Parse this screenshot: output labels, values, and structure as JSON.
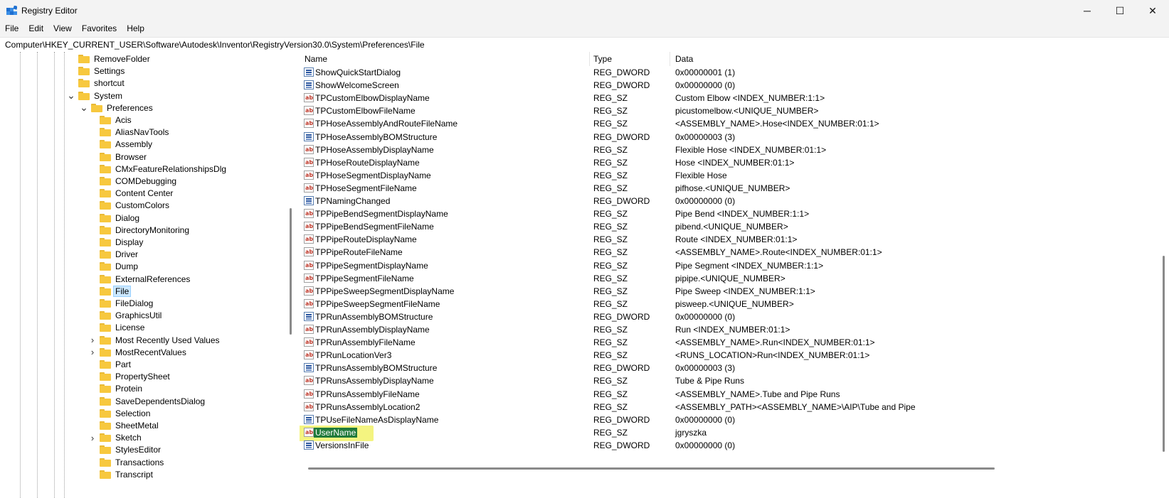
{
  "window": {
    "title": "Registry Editor",
    "minimize_glyph": "─",
    "maximize_glyph": "☐",
    "close_glyph": "✕"
  },
  "menu": [
    "File",
    "Edit",
    "View",
    "Favorites",
    "Help"
  ],
  "address": "Computer\\HKEY_CURRENT_USER\\Software\\Autodesk\\Inventor\\RegistryVersion30.0\\System\\Preferences\\File",
  "tree": {
    "items": [
      {
        "label": "RemoveFolder",
        "level": 1,
        "chevron": ""
      },
      {
        "label": "Settings",
        "level": 1,
        "chevron": ""
      },
      {
        "label": "shortcut",
        "level": 1,
        "chevron": ""
      },
      {
        "label": "System",
        "level": 1,
        "chevron": "expanded"
      },
      {
        "label": "Preferences",
        "level": 2,
        "chevron": "expanded"
      },
      {
        "label": "Acis",
        "level": 3,
        "chevron": ""
      },
      {
        "label": "AliasNavTools",
        "level": 3,
        "chevron": ""
      },
      {
        "label": "Assembly",
        "level": 3,
        "chevron": ""
      },
      {
        "label": "Browser",
        "level": 3,
        "chevron": ""
      },
      {
        "label": "CMxFeatureRelationshipsDlg",
        "level": 3,
        "chevron": ""
      },
      {
        "label": "COMDebugging",
        "level": 3,
        "chevron": ""
      },
      {
        "label": "Content Center",
        "level": 3,
        "chevron": ""
      },
      {
        "label": "CustomColors",
        "level": 3,
        "chevron": ""
      },
      {
        "label": "Dialog",
        "level": 3,
        "chevron": ""
      },
      {
        "label": "DirectoryMonitoring",
        "level": 3,
        "chevron": ""
      },
      {
        "label": "Display",
        "level": 3,
        "chevron": ""
      },
      {
        "label": "Driver",
        "level": 3,
        "chevron": ""
      },
      {
        "label": "Dump",
        "level": 3,
        "chevron": ""
      },
      {
        "label": "ExternalReferences",
        "level": 3,
        "chevron": ""
      },
      {
        "label": "File",
        "level": 3,
        "chevron": "",
        "selected": true
      },
      {
        "label": "FileDialog",
        "level": 3,
        "chevron": ""
      },
      {
        "label": "GraphicsUtil",
        "level": 3,
        "chevron": ""
      },
      {
        "label": "License",
        "level": 3,
        "chevron": ""
      },
      {
        "label": "Most Recently Used Values",
        "level": 3,
        "chevron": "collapsed"
      },
      {
        "label": "MostRecentValues",
        "level": 3,
        "chevron": "collapsed"
      },
      {
        "label": "Part",
        "level": 3,
        "chevron": ""
      },
      {
        "label": "PropertySheet",
        "level": 3,
        "chevron": ""
      },
      {
        "label": "Protein",
        "level": 3,
        "chevron": ""
      },
      {
        "label": "SaveDependentsDialog",
        "level": 3,
        "chevron": ""
      },
      {
        "label": "Selection",
        "level": 3,
        "chevron": ""
      },
      {
        "label": "SheetMetal",
        "level": 3,
        "chevron": ""
      },
      {
        "label": "Sketch",
        "level": 3,
        "chevron": "collapsed"
      },
      {
        "label": "StylesEditor",
        "level": 3,
        "chevron": ""
      },
      {
        "label": "Transactions",
        "level": 3,
        "chevron": ""
      },
      {
        "label": "Transcript",
        "level": 3,
        "chevron": ""
      }
    ]
  },
  "list": {
    "columns": [
      "Name",
      "Type",
      "Data"
    ],
    "rows": [
      {
        "icon": "dword-icon",
        "name": "ShowQuickStartDialog",
        "type": "REG_DWORD",
        "data": "0x00000001 (1)"
      },
      {
        "icon": "dword-icon",
        "name": "ShowWelcomeScreen",
        "type": "REG_DWORD",
        "data": "0x00000000 (0)"
      },
      {
        "icon": "string-icon",
        "name": "TPCustomElbowDisplayName",
        "type": "REG_SZ",
        "data": "Custom Elbow <INDEX_NUMBER:1:1>"
      },
      {
        "icon": "string-icon",
        "name": "TPCustomElbowFileName",
        "type": "REG_SZ",
        "data": "picustomelbow.<UNIQUE_NUMBER>"
      },
      {
        "icon": "string-icon",
        "name": "TPHoseAssemblyAndRouteFileName",
        "type": "REG_SZ",
        "data": "<ASSEMBLY_NAME>.Hose<INDEX_NUMBER:01:1>"
      },
      {
        "icon": "dword-icon",
        "name": "TPHoseAssemblyBOMStructure",
        "type": "REG_DWORD",
        "data": "0x00000003 (3)"
      },
      {
        "icon": "string-icon",
        "name": "TPHoseAssemblyDisplayName",
        "type": "REG_SZ",
        "data": "Flexible Hose <INDEX_NUMBER:01:1>"
      },
      {
        "icon": "string-icon",
        "name": "TPHoseRouteDisplayName",
        "type": "REG_SZ",
        "data": "Hose <INDEX_NUMBER:01:1>"
      },
      {
        "icon": "string-icon",
        "name": "TPHoseSegmentDisplayName",
        "type": "REG_SZ",
        "data": "Flexible Hose"
      },
      {
        "icon": "string-icon",
        "name": "TPHoseSegmentFileName",
        "type": "REG_SZ",
        "data": "pifhose.<UNIQUE_NUMBER>"
      },
      {
        "icon": "dword-icon",
        "name": "TPNamingChanged",
        "type": "REG_DWORD",
        "data": "0x00000000 (0)"
      },
      {
        "icon": "string-icon",
        "name": "TPPipeBendSegmentDisplayName",
        "type": "REG_SZ",
        "data": "Pipe Bend <INDEX_NUMBER:1:1>"
      },
      {
        "icon": "string-icon",
        "name": "TPPipeBendSegmentFileName",
        "type": "REG_SZ",
        "data": "pibend.<UNIQUE_NUMBER>"
      },
      {
        "icon": "string-icon",
        "name": "TPPipeRouteDisplayName",
        "type": "REG_SZ",
        "data": "Route <INDEX_NUMBER:01:1>"
      },
      {
        "icon": "string-icon",
        "name": "TPPipeRouteFileName",
        "type": "REG_SZ",
        "data": "<ASSEMBLY_NAME>.Route<INDEX_NUMBER:01:1>"
      },
      {
        "icon": "string-icon",
        "name": "TPPipeSegmentDisplayName",
        "type": "REG_SZ",
        "data": "Pipe Segment <INDEX_NUMBER:1:1>"
      },
      {
        "icon": "string-icon",
        "name": "TPPipeSegmentFileName",
        "type": "REG_SZ",
        "data": "pipipe.<UNIQUE_NUMBER>"
      },
      {
        "icon": "string-icon",
        "name": "TPPipeSweepSegmentDisplayName",
        "type": "REG_SZ",
        "data": "Pipe Sweep <INDEX_NUMBER:1:1>"
      },
      {
        "icon": "string-icon",
        "name": "TPPipeSweepSegmentFileName",
        "type": "REG_SZ",
        "data": "pisweep.<UNIQUE_NUMBER>"
      },
      {
        "icon": "dword-icon",
        "name": "TPRunAssemblyBOMStructure",
        "type": "REG_DWORD",
        "data": "0x00000000 (0)"
      },
      {
        "icon": "string-icon",
        "name": "TPRunAssemblyDisplayName",
        "type": "REG_SZ",
        "data": "Run <INDEX_NUMBER:01:1>"
      },
      {
        "icon": "string-icon",
        "name": "TPRunAssemblyFileName",
        "type": "REG_SZ",
        "data": "<ASSEMBLY_NAME>.Run<INDEX_NUMBER:01:1>"
      },
      {
        "icon": "string-icon",
        "name": "TPRunLocationVer3",
        "type": "REG_SZ",
        "data": "<RUNS_LOCATION>Run<INDEX_NUMBER:01:1>"
      },
      {
        "icon": "dword-icon",
        "name": "TPRunsAssemblyBOMStructure",
        "type": "REG_DWORD",
        "data": "0x00000003 (3)"
      },
      {
        "icon": "string-icon",
        "name": "TPRunsAssemblyDisplayName",
        "type": "REG_SZ",
        "data": "Tube & Pipe Runs"
      },
      {
        "icon": "string-icon",
        "name": "TPRunsAssemblyFileName",
        "type": "REG_SZ",
        "data": "<ASSEMBLY_NAME>.Tube and Pipe Runs"
      },
      {
        "icon": "string-icon",
        "name": "TPRunsAssemblyLocation2",
        "type": "REG_SZ",
        "data": "<ASSEMBLY_PATH><ASSEMBLY_NAME>\\AIP\\Tube and Pipe"
      },
      {
        "icon": "dword-icon",
        "name": "TPUseFileNameAsDisplayName",
        "type": "REG_DWORD",
        "data": "0x00000000 (0)"
      },
      {
        "icon": "string-icon",
        "name": "UserName",
        "type": "REG_SZ",
        "data": "jgryszka",
        "selected": true
      },
      {
        "icon": "dword-icon",
        "name": "VersionsInFile",
        "type": "REG_DWORD",
        "data": "0x00000000 (0)"
      }
    ]
  },
  "string_icon_text": "ab"
}
